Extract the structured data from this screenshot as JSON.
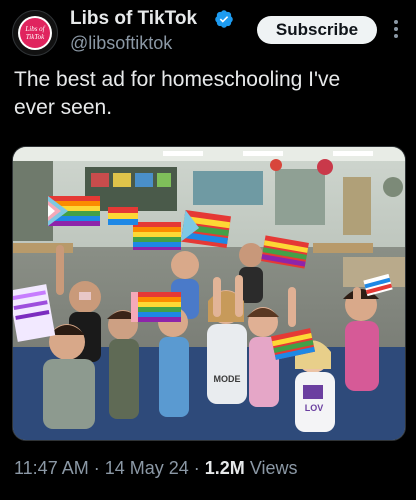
{
  "account": {
    "display_name": "Libs of TikTok",
    "handle": "@libsoftiktok",
    "avatar_text_top": "Libs of",
    "avatar_text_bottom": "TikTok",
    "verified": true,
    "verified_color": "#1d9bf0"
  },
  "header": {
    "subscribe_label": "Subscribe",
    "more_icon": "more-vertical-icon"
  },
  "tweet": {
    "line1": "The best ad for homeschooling I've",
    "line2": "ever seen."
  },
  "media": {
    "type": "photo",
    "shirt_text": "MODE",
    "shirt_text2": "LOV"
  },
  "meta": {
    "time": "11:47 AM",
    "separator1": " · ",
    "date": "14 May 24",
    "separator2": " · ",
    "views_count": "1.2M",
    "views_label": " Views"
  },
  "colors": {
    "background": "#000000",
    "text_primary": "#e7e9ea",
    "text_secondary": "#8b98a5",
    "subscribe_bg": "#eff3f4",
    "verified_blue": "#1d9bf0"
  }
}
